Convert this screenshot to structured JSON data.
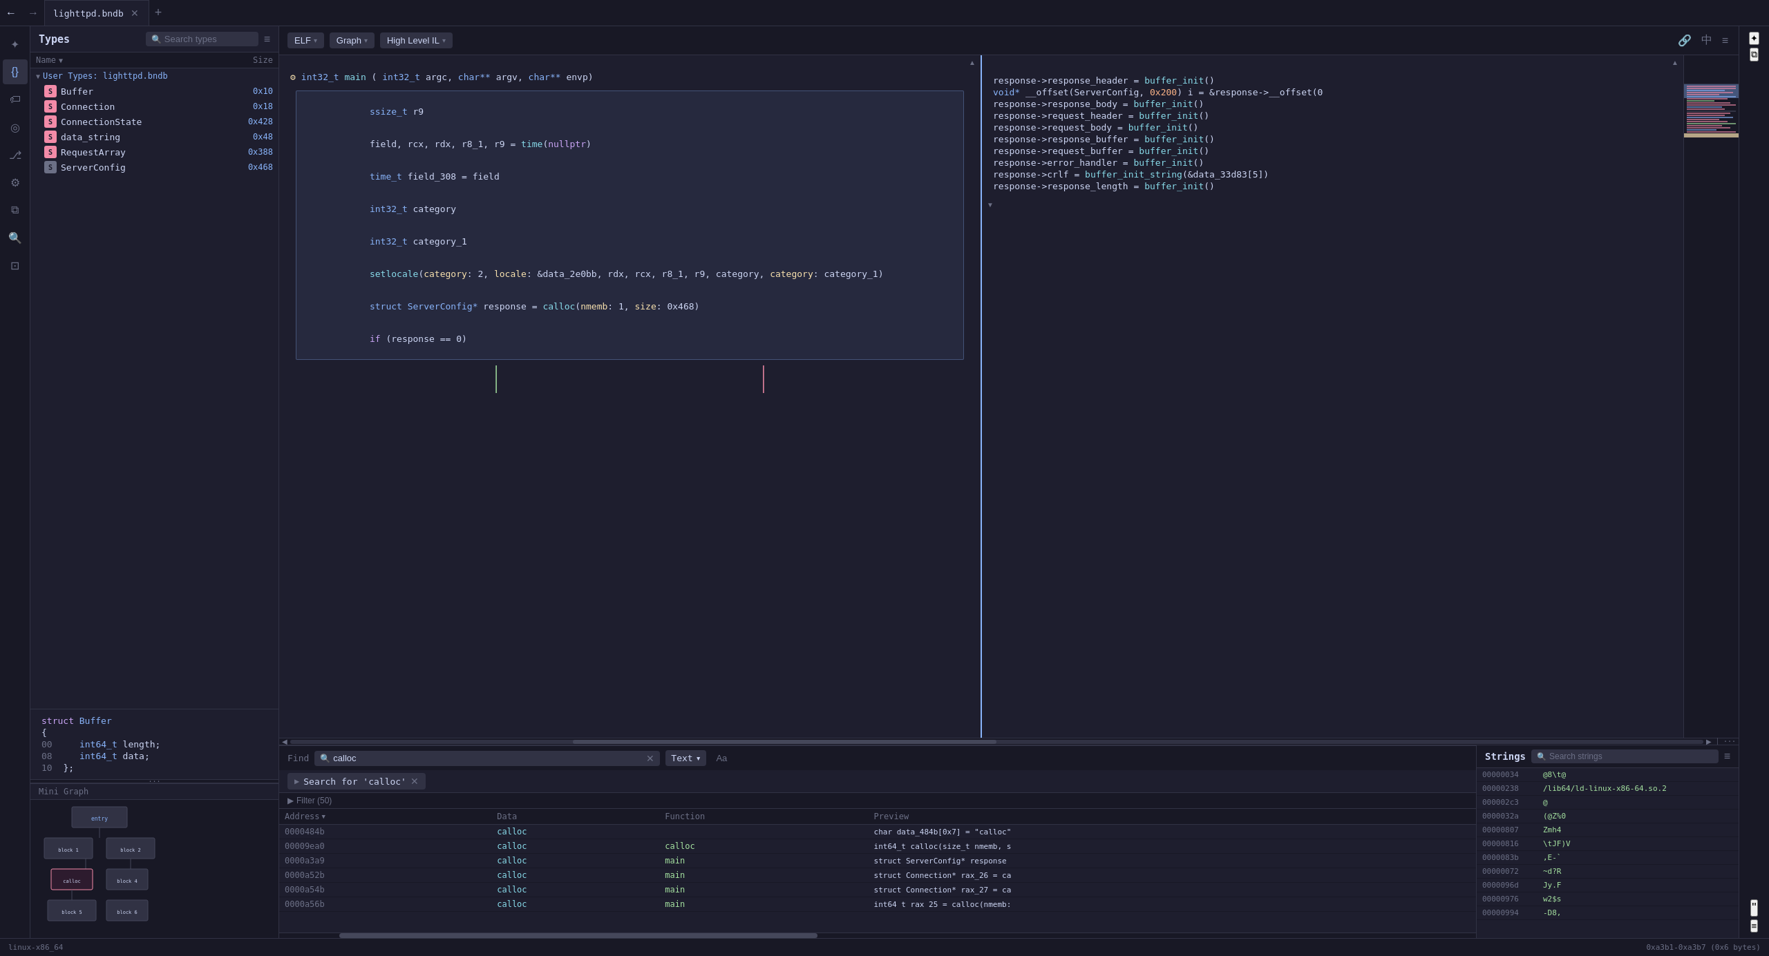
{
  "tabs": [
    {
      "label": "lighttpd.bndb",
      "active": true
    }
  ],
  "toolbar": {
    "elf_label": "ELF",
    "graph_label": "Graph",
    "hlil_label": "High Level IL"
  },
  "types_panel": {
    "title": "Types",
    "search_placeholder": "Search types",
    "columns": {
      "name": "Name",
      "size": "Size"
    },
    "group": "User Types: lighttpd.bndb",
    "items": [
      {
        "name": "Buffer",
        "size": "0x10"
      },
      {
        "name": "Connection",
        "size": "0x18"
      },
      {
        "name": "ConnectionState",
        "size": "0x428"
      },
      {
        "name": "data_string",
        "size": "0x48"
      },
      {
        "name": "RequestArray",
        "size": "0x388"
      },
      {
        "name": "ServerConfig",
        "size": "0x468"
      }
    ],
    "struct_preview": {
      "type_name": "Buffer",
      "fields": [
        {
          "offset": "00",
          "type": "int64_t",
          "name": "length"
        },
        {
          "offset": "08",
          "type": "int64_t",
          "name": "data"
        }
      ]
    }
  },
  "mini_graph": {
    "title": "Mini Graph"
  },
  "code_view": {
    "func_signature": "int32_t main(int32_t argc, char** argv, char** envp)",
    "code_lines": [
      "ssize_t r9",
      "field, rcx, rdx, r8_1, r9 = time(nullptr)",
      "time_t field_308 = field",
      "int32_t category",
      "int32_t category_1",
      "setlocale(category: 2, locale: &data_2e0bb, rdx, rcx, r8_1, r9, category, category: category_1)",
      "struct ServerConfig* response = calloc(nmemb: 1, size: 0x468)",
      "if (response == 0)"
    ],
    "right_code_lines": [
      "response->response_header = buffer_init()",
      "void* __offset(ServerConfig, 0x200) i = &response->__offset(0",
      "response->response_body = buffer_init()",
      "response->request_header = buffer_init()",
      "response->request_body = buffer_init()",
      "response->response_buffer = buffer_init()",
      "response->request_buffer = buffer_init()",
      "response->error_handler = buffer_init()",
      "response->crlf = buffer_init_string(&data_33d83[5])",
      "response->response_length = buffer_init()"
    ]
  },
  "find_bar": {
    "label": "Find",
    "query": "calloc",
    "search_for_label": "Search for 'calloc'",
    "filter_label": "Filter (50)",
    "type_label": "Text",
    "match_case_label": "Aa",
    "columns": {
      "address": "Address",
      "data": "Data",
      "function": "Function",
      "preview": "Preview"
    },
    "results": [
      {
        "address": "0000484b",
        "data": "calloc",
        "function": "",
        "preview": "char data_484b[0x7] = \"calloc\""
      },
      {
        "address": "00009ea0",
        "data": "calloc",
        "function": "calloc",
        "preview": "int64_t calloc(size_t nmemb, s"
      },
      {
        "address": "0000a3a9",
        "data": "calloc",
        "function": "main",
        "preview": "struct ServerConfig* response"
      },
      {
        "address": "0000a52b",
        "data": "calloc",
        "function": "main",
        "preview": "struct Connection* rax_26 = ca"
      },
      {
        "address": "0000a54b",
        "data": "calloc",
        "function": "main",
        "preview": "struct Connection* rax_27 = ca"
      },
      {
        "address": "0000a56b",
        "data": "calloc",
        "function": "main",
        "preview": "int64 t rax 25 = calloc(nmemb:"
      }
    ]
  },
  "strings_panel": {
    "title": "Strings",
    "search_placeholder": "Search strings",
    "strings": [
      {
        "address": "00000034",
        "value": "@8\\t@"
      },
      {
        "address": "00000238",
        "value": "/lib64/ld-linux-x86-64.so.2"
      },
      {
        "address": "000002c3",
        "value": "@"
      },
      {
        "address": "0000032a",
        "value": "(@Z%0"
      },
      {
        "address": "00000807",
        "value": "Zmh4"
      },
      {
        "address": "00000816",
        "value": "\\tJF)V"
      },
      {
        "address": "0000083b",
        "value": ",E-`"
      },
      {
        "address": "00000072",
        "value": "~d?R"
      },
      {
        "address": "0000096d",
        "value": "Jy.F"
      },
      {
        "address": "00000976",
        "value": "w2$s"
      },
      {
        "address": "00000994",
        "value": "-D8,"
      }
    ]
  },
  "status_bar": {
    "platform": "linux-x86_64",
    "address_range": "0xa3b1-0xa3b7 (0x6 bytes)"
  },
  "icons": {
    "search": "🔍",
    "menu": "≡",
    "close": "✕",
    "arrow_down": "▾",
    "arrow_right": "▶",
    "arrow_left": "◀",
    "chevron_down": "⌄",
    "back": "←",
    "forward": "→",
    "plus": "+",
    "star": "✦",
    "tag": "🏷",
    "cursor": "⊕",
    "branch": "⎇",
    "settings": "⚙",
    "list": "☰",
    "layers": "⧉",
    "type": "{}"
  }
}
